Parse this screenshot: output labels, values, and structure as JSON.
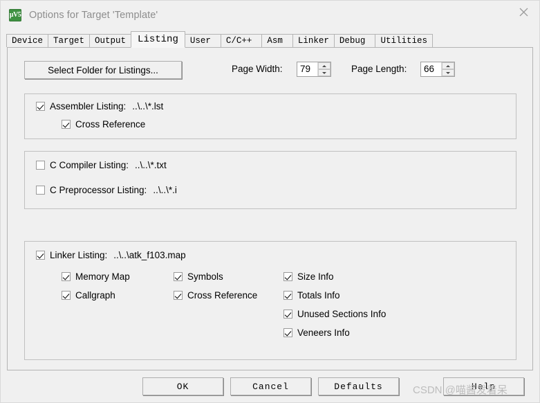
{
  "window": {
    "title": "Options for Target 'Template'",
    "icon": "keil-uvision5-icon",
    "icon_glyph": "µV5",
    "close_icon": "close-icon",
    "accent_icon_color": "#3f9142"
  },
  "tabs": [
    {
      "label": "Device",
      "active": false
    },
    {
      "label": "Target",
      "active": false
    },
    {
      "label": "Output",
      "active": false
    },
    {
      "label": "Listing",
      "active": true
    },
    {
      "label": "User",
      "active": false
    },
    {
      "label": "C/C++",
      "active": false
    },
    {
      "label": "Asm",
      "active": false
    },
    {
      "label": "Linker",
      "active": false
    },
    {
      "label": "Debug",
      "active": false
    },
    {
      "label": "Utilities",
      "active": false
    }
  ],
  "toolbar": {
    "select_folder_label": "Select Folder for Listings...",
    "page_width_label": "Page Width:",
    "page_width_value": "79",
    "page_length_label": "Page Length:",
    "page_length_value": "66"
  },
  "assembler_group": {
    "assembler_listing": {
      "label": "Assembler Listing:",
      "path": "..\\..\\*.lst",
      "checked": true
    },
    "cross_reference": {
      "label": "Cross Reference",
      "checked": true
    }
  },
  "compiler_group": {
    "c_compiler_listing": {
      "label": "C Compiler Listing:",
      "path": "..\\..\\*.txt",
      "checked": false
    },
    "c_preprocessor_listing": {
      "label": "C Preprocessor Listing:",
      "path": "..\\..\\*.i",
      "checked": false
    }
  },
  "linker_group": {
    "linker_listing": {
      "label": "Linker Listing:",
      "path": "..\\..\\atk_f103.map",
      "checked": true
    },
    "options": [
      {
        "label": "Memory Map",
        "checked": true
      },
      {
        "label": "Callgraph",
        "checked": true
      },
      {
        "label": "Symbols",
        "checked": true
      },
      {
        "label": "Cross Reference",
        "checked": true
      },
      {
        "label": "Size Info",
        "checked": true
      },
      {
        "label": "Totals Info",
        "checked": true
      },
      {
        "label": "Unused Sections Info",
        "checked": true
      },
      {
        "label": "Veneers Info",
        "checked": true
      }
    ]
  },
  "buttons": {
    "ok": "OK",
    "cancel": "Cancel",
    "defaults": "Defaults",
    "help": "Help"
  },
  "watermark": {
    "text": "CSDN @喵酱发着呆"
  }
}
